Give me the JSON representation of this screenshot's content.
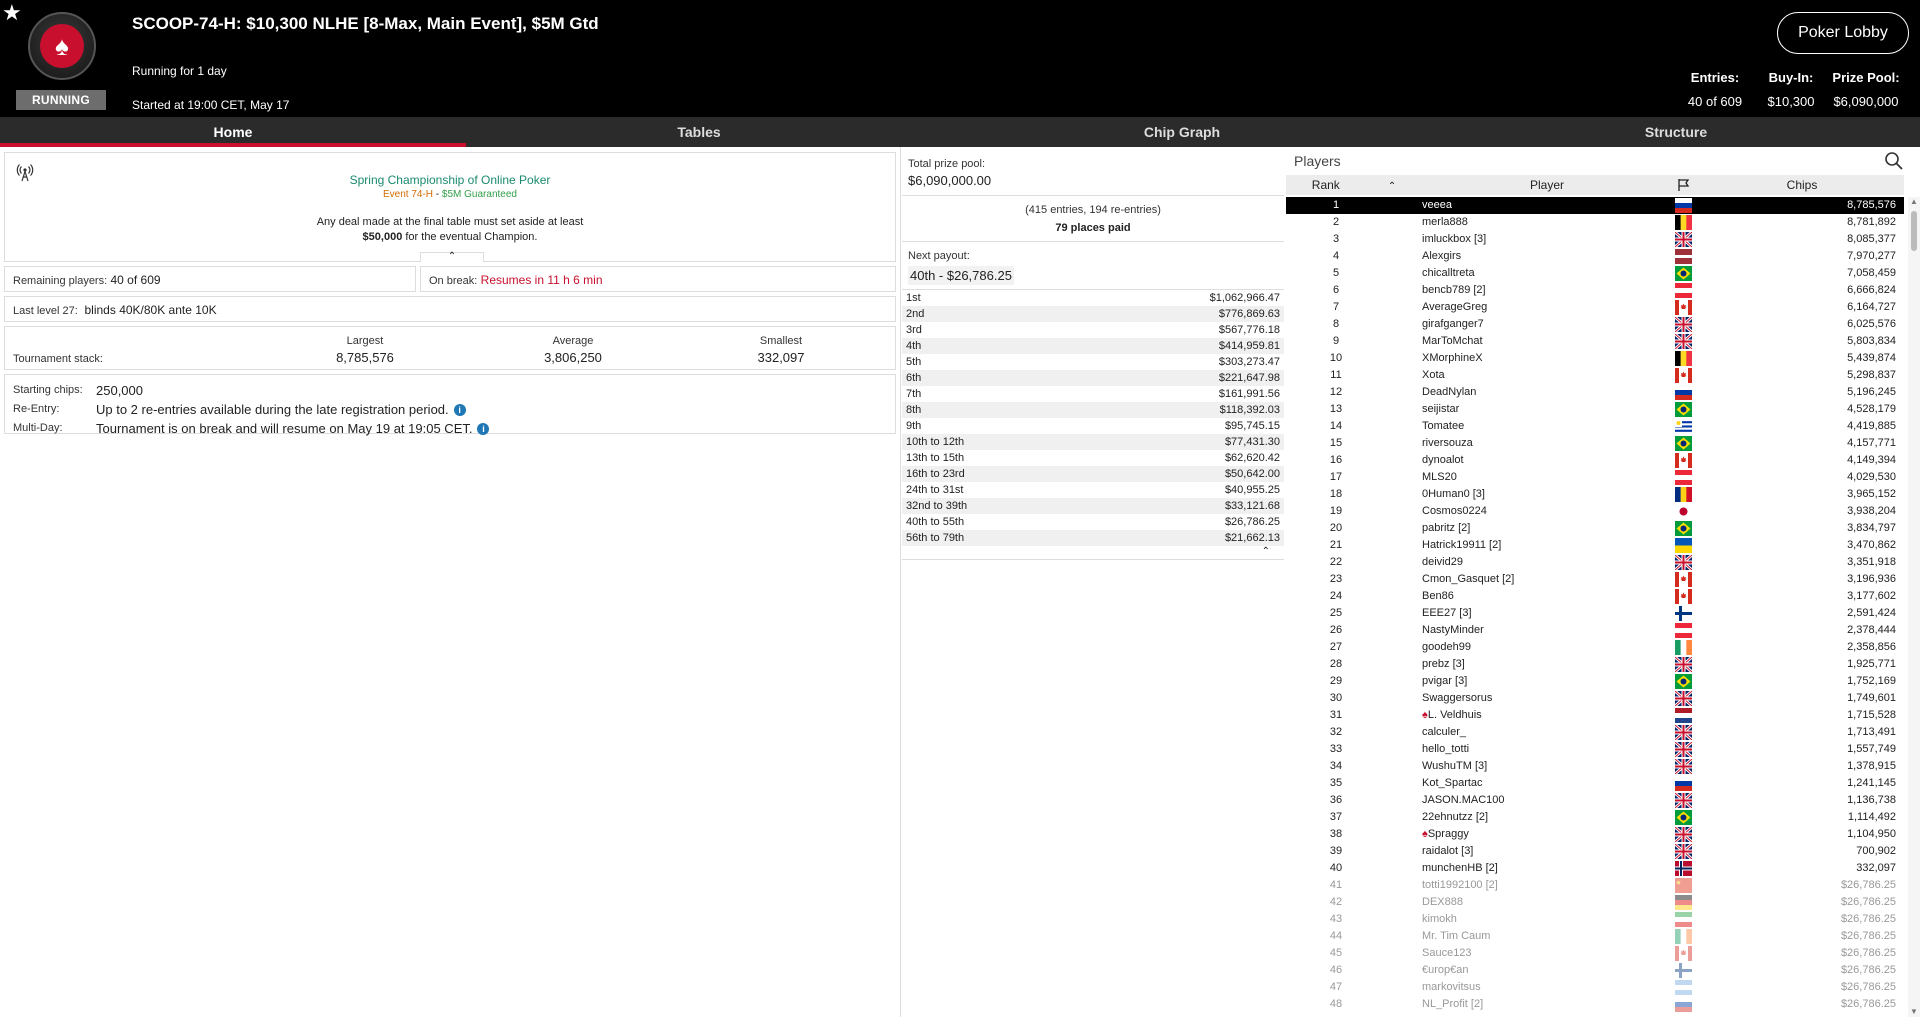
{
  "header": {
    "status": "RUNNING",
    "title": "SCOOP-74-H: $10,300 NLHE [8-Max, Main Event], $5M Gtd",
    "running_for": "Running for 1 day",
    "started": "Started at 19:00 CET, May 17",
    "lobby_button": "Poker Lobby",
    "stats": [
      {
        "label": "Entries:",
        "value": "40 of 609"
      },
      {
        "label": "Buy-In:",
        "value": "$10,300"
      },
      {
        "label": "Prize Pool:",
        "value": "$6,090,000"
      }
    ]
  },
  "tabs": [
    {
      "label": "Home",
      "active": true
    },
    {
      "label": "Tables",
      "active": false
    },
    {
      "label": "Chip Graph",
      "active": false
    },
    {
      "label": "Structure",
      "active": false
    }
  ],
  "announcement": {
    "title": "Spring Championship of Online Poker",
    "event": "Event 74-H",
    "sep": " - ",
    "guarantee": "$5M Guaranteed",
    "deal_text": "Any deal made at the final table must set aside at least",
    "deal_amount": "$50,000",
    "deal_rest": " for the eventual Champion."
  },
  "remaining": {
    "label": "Remaining players:",
    "value": "40 of 609"
  },
  "on_break": {
    "label": "On break:",
    "value": "Resumes in 11 h 6 min"
  },
  "last_level": {
    "label": "Last level 27:",
    "value": "blinds 40K/80K ante 10K"
  },
  "stack": {
    "label": "Tournament stack:",
    "cols": [
      {
        "header": "Largest",
        "value": "8,785,576"
      },
      {
        "header": "Average",
        "value": "3,806,250"
      },
      {
        "header": "Smallest",
        "value": "332,097"
      }
    ]
  },
  "info": {
    "starting": {
      "label": "Starting chips:",
      "value": "250,000"
    },
    "reentry": {
      "label": "Re-Entry:",
      "value": "Up to 2 re-entries available during the late registration period."
    },
    "multiday": {
      "label": "Multi-Day:",
      "value": "Tournament is on break and will resume on May 19 at 19:05 CET."
    }
  },
  "prize": {
    "total_label": "Total prize pool:",
    "total_value": "$6,090,000.00",
    "entries_text": "(415 entries, 194 re-entries)",
    "places_paid": "79 places paid",
    "next_label": "Next payout:",
    "next_value": "40th - $26,786.25",
    "rows": [
      {
        "place": "1st",
        "amount": "$1,062,966.47"
      },
      {
        "place": "2nd",
        "amount": "$776,869.63"
      },
      {
        "place": "3rd",
        "amount": "$567,776.18"
      },
      {
        "place": "4th",
        "amount": "$414,959.81"
      },
      {
        "place": "5th",
        "amount": "$303,273.47"
      },
      {
        "place": "6th",
        "amount": "$221,647.98"
      },
      {
        "place": "7th",
        "amount": "$161,991.56"
      },
      {
        "place": "8th",
        "amount": "$118,392.03"
      },
      {
        "place": "9th",
        "amount": "$95,745.15"
      },
      {
        "place": "10th to 12th",
        "amount": "$77,431.30"
      },
      {
        "place": "13th to 15th",
        "amount": "$62,620.42"
      },
      {
        "place": "16th to 23rd",
        "amount": "$50,642.00"
      },
      {
        "place": "24th to 31st",
        "amount": "$40,955.25"
      },
      {
        "place": "32nd to 39th",
        "amount": "$33,121.68"
      },
      {
        "place": "40th to 55th",
        "amount": "$26,786.25"
      },
      {
        "place": "56th to 79th",
        "amount": "$21,662.13"
      }
    ]
  },
  "players": {
    "title": "Players",
    "headers": {
      "rank": "Rank",
      "player": "Player",
      "chips": "Chips"
    },
    "rows": [
      {
        "rank": "1",
        "name": "veeea",
        "chips": "8,785,576",
        "flag": "ru",
        "sel": true
      },
      {
        "rank": "2",
        "name": "merla888",
        "chips": "8,781,892",
        "flag": "be"
      },
      {
        "rank": "3",
        "name": "imluckbox [3]",
        "chips": "8,085,377",
        "flag": "gb"
      },
      {
        "rank": "4",
        "name": "Alexgirs",
        "chips": "7,970,277",
        "flag": "lv"
      },
      {
        "rank": "5",
        "name": "chicalltreta",
        "chips": "7,058,459",
        "flag": "br"
      },
      {
        "rank": "6",
        "name": "bencb789 [2]",
        "chips": "6,666,824",
        "flag": "at"
      },
      {
        "rank": "7",
        "name": "AverageGreg",
        "chips": "6,164,727",
        "flag": "ca"
      },
      {
        "rank": "8",
        "name": "girafganger7",
        "chips": "6,025,576",
        "flag": "gb"
      },
      {
        "rank": "9",
        "name": "MarToMchat",
        "chips": "5,803,834",
        "flag": "gb"
      },
      {
        "rank": "10",
        "name": "XMorphineX",
        "chips": "5,439,874",
        "flag": "be"
      },
      {
        "rank": "11",
        "name": "Xota",
        "chips": "5,298,837",
        "flag": "ca"
      },
      {
        "rank": "12",
        "name": "DeadNylan",
        "chips": "5,196,245",
        "flag": "ru"
      },
      {
        "rank": "13",
        "name": "seijistar",
        "chips": "4,528,179",
        "flag": "br"
      },
      {
        "rank": "14",
        "name": "Tomatee",
        "chips": "4,419,885",
        "flag": "uy"
      },
      {
        "rank": "15",
        "name": "riversouza",
        "chips": "4,157,771",
        "flag": "br"
      },
      {
        "rank": "16",
        "name": "dynoalot",
        "chips": "4,149,394",
        "flag": "ca"
      },
      {
        "rank": "17",
        "name": "MLS20",
        "chips": "4,029,530",
        "flag": "at"
      },
      {
        "rank": "18",
        "name": "0Human0 [3]",
        "chips": "3,965,152",
        "flag": "ro"
      },
      {
        "rank": "19",
        "name": "Cosmos0224",
        "chips": "3,938,204",
        "flag": "jp"
      },
      {
        "rank": "20",
        "name": "pabritz [2]",
        "chips": "3,834,797",
        "flag": "br"
      },
      {
        "rank": "21",
        "name": "Hatrick19911 [2]",
        "chips": "3,470,862",
        "flag": "ua"
      },
      {
        "rank": "22",
        "name": "deivid29",
        "chips": "3,351,918",
        "flag": "gb"
      },
      {
        "rank": "23",
        "name": "Cmon_Gasquet [2]",
        "chips": "3,196,936",
        "flag": "ca"
      },
      {
        "rank": "24",
        "name": "Ben86",
        "chips": "3,177,602",
        "flag": "ca"
      },
      {
        "rank": "25",
        "name": "EEE27 [3]",
        "chips": "2,591,424",
        "flag": "fi"
      },
      {
        "rank": "26",
        "name": "NastyMinder",
        "chips": "2,378,444",
        "flag": "at"
      },
      {
        "rank": "27",
        "name": "goodeh99",
        "chips": "2,358,856",
        "flag": "ie"
      },
      {
        "rank": "28",
        "name": "prebz [3]",
        "chips": "1,925,771",
        "flag": "gb"
      },
      {
        "rank": "29",
        "name": "pvigar [3]",
        "chips": "1,752,169",
        "flag": "br"
      },
      {
        "rank": "30",
        "name": "Swaggersorus",
        "chips": "1,749,601",
        "flag": "gb"
      },
      {
        "rank": "31",
        "name": "L. Veldhuis",
        "chips": "1,715,528",
        "flag": "nl",
        "star": true
      },
      {
        "rank": "32",
        "name": "calculer_",
        "chips": "1,713,491",
        "flag": "gb"
      },
      {
        "rank": "33",
        "name": "hello_totti",
        "chips": "1,557,749",
        "flag": "gb"
      },
      {
        "rank": "34",
        "name": "WushuTM [3]",
        "chips": "1,378,915",
        "flag": "gb"
      },
      {
        "rank": "35",
        "name": "Kot_Spartac",
        "chips": "1,241,145",
        "flag": "ru"
      },
      {
        "rank": "36",
        "name": "JASON.MAC100",
        "chips": "1,136,738",
        "flag": "gb"
      },
      {
        "rank": "37",
        "name": "22ehnutzz [2]",
        "chips": "1,114,492",
        "flag": "br"
      },
      {
        "rank": "38",
        "name": "Spraggy",
        "chips": "1,104,950",
        "flag": "gb",
        "star": true
      },
      {
        "rank": "39",
        "name": "raidalot [3]",
        "chips": "700,902",
        "flag": "gb"
      },
      {
        "rank": "40",
        "name": "munchenHB [2]",
        "chips": "332,097",
        "flag": "no"
      },
      {
        "rank": "41",
        "name": "totti1992100 [2]",
        "chips": "$26,786.25",
        "flag": "cn",
        "out": true
      },
      {
        "rank": "42",
        "name": "DEX888",
        "chips": "$26,786.25",
        "flag": "de",
        "out": true
      },
      {
        "rank": "43",
        "name": "kimokh",
        "chips": "$26,786.25",
        "flag": "ir",
        "out": true
      },
      {
        "rank": "44",
        "name": "Mr. Tim Caum",
        "chips": "$26,786.25",
        "flag": "ie",
        "out": true
      },
      {
        "rank": "45",
        "name": "Sauce123",
        "chips": "$26,786.25",
        "flag": "ca",
        "out": true
      },
      {
        "rank": "46",
        "name": "€urop€an",
        "chips": "$26,786.25",
        "flag": "fi",
        "out": true
      },
      {
        "rank": "47",
        "name": "markovitsus",
        "chips": "$26,786.25",
        "flag": "ar",
        "out": true
      },
      {
        "rank": "48",
        "name": "NL_Profit [2]",
        "chips": "$26,786.25",
        "flag": "ru",
        "out": true
      }
    ]
  }
}
